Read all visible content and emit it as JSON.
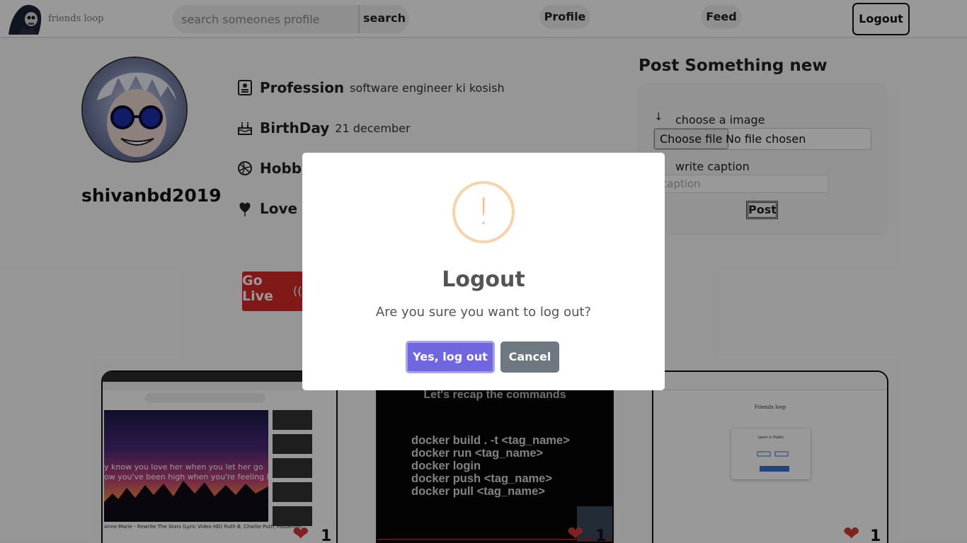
{
  "navbar": {
    "brand": "friends loop",
    "search": {
      "placeholder": "search someones profile",
      "value": "",
      "button_label": "search"
    },
    "profile_label": "Profile",
    "feed_label": "Feed",
    "logout_label": "Logout"
  },
  "profile": {
    "username": "shivanbd2019",
    "profession": {
      "label": "Profession",
      "value": "software engineer ki kosish"
    },
    "birthday": {
      "label": "BirthDay",
      "value": "21 december"
    },
    "hobby": {
      "label": "Hobby",
      "value": ""
    },
    "love": {
      "label": "Love to",
      "value": ""
    },
    "go_live_label": "Go Live",
    "go_live_icon": "((•))"
  },
  "post_panel": {
    "title": "Post Something new",
    "image_label": "choose a image",
    "file_button": "Choose file",
    "file_status": "No file chosen",
    "caption_label": "write caption",
    "caption_placeholder": "caption",
    "post_button": "Post"
  },
  "posts": [
    {
      "likes": "1",
      "lyric_line1": "y know you love her when you let her go",
      "lyric_line2": "ow you've been high when you're feeling low",
      "video_title": "Anne-Marie - Rewrite The Stars (Lyric Video HD) Ruth B, Charlie Puth, Passenger"
    },
    {
      "likes": "1",
      "heading": "Let's recap the commands",
      "commands": "docker build . -t <tag_name>\ndocker run <tag_name>\ndocker login\ndocker push <tag_name>\ndocker pull <tag_name>"
    },
    {
      "likes": "1",
      "brand": "Friends loop",
      "card_title": "Learn in Public"
    }
  ],
  "modal": {
    "icon": "!",
    "title": "Logout",
    "text": "Are you sure you want to log out?",
    "confirm_label": "Yes, log out",
    "cancel_label": "Cancel"
  },
  "colors": {
    "confirm": "#7066e0",
    "cancel": "#6e7881",
    "warning": "#f8bb86",
    "go_live": "#d82b2b",
    "heart": "#d43a3a"
  }
}
